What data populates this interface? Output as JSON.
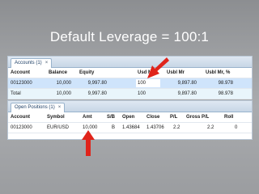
{
  "headline": "Default Leverage = 100:1",
  "accounts": {
    "tab_label": "Accounts (1)",
    "close_icon": "×",
    "columns": [
      "Account",
      "Balance",
      "Equity",
      "Usd Mr",
      "Usbl Mr",
      "Usbl Mr, %"
    ],
    "rows": [
      [
        "00123000",
        "10,000",
        "9,997.80",
        "100",
        "9,897.80",
        "98.978"
      ],
      [
        "Total",
        "10,000",
        "9,997.80",
        "100",
        "9,897.80",
        "98.978"
      ]
    ]
  },
  "positions": {
    "tab_label": "Open Positions (1)",
    "close_icon": "×",
    "columns": [
      "Account",
      "Symbol",
      "Amt",
      "S/B",
      "Open",
      "Close",
      "P/L",
      "Gross P/L",
      "Roll"
    ],
    "rows": [
      [
        "00123000",
        "EUR/USD",
        "10,000",
        "B",
        "1.43684",
        "1.43706",
        "2.2",
        "2.2",
        "0"
      ]
    ]
  },
  "annotations": {
    "arrow_color": "#e0241b"
  }
}
